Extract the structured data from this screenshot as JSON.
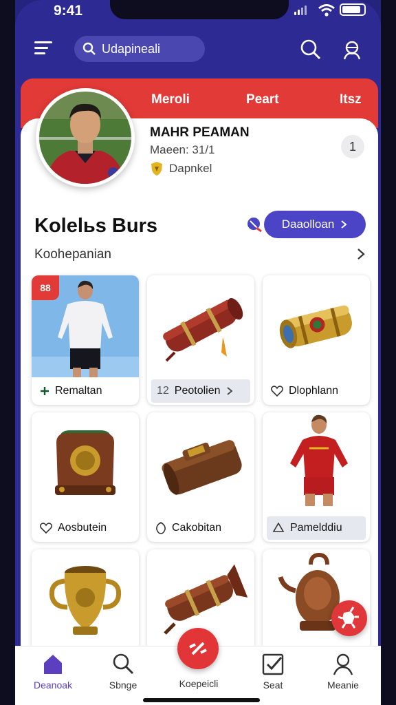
{
  "status": {
    "time": "9:41"
  },
  "search": {
    "text": "Udapineali"
  },
  "tabs": [
    "Meroli",
    "Peart",
    "Itsz"
  ],
  "profile": {
    "name": "MAHR PEAMAN",
    "meta": "Maeen: 31/1",
    "badge": "Dapnkel",
    "action": "1"
  },
  "section": {
    "title": "Kolelьs Burs",
    "button": "Daaolloan",
    "subtitle": "Koohepanian"
  },
  "grid": [
    {
      "label": "Remaltan",
      "icon": "plus-icon"
    },
    {
      "label": "Peotolien",
      "prefix": "12",
      "icon": "chevron-right-icon"
    },
    {
      "label": "Dlophlann",
      "icon": "heart-icon"
    },
    {
      "label": "Aosbutein",
      "icon": "heart-icon"
    },
    {
      "label": "Cakobitan",
      "icon": "leaf-icon"
    },
    {
      "label": "Pamelddiu",
      "icon": "recycle-icon"
    }
  ],
  "tile_tag": "88",
  "nav": [
    {
      "label": "Deanoak"
    },
    {
      "label": "Sbnge"
    },
    {
      "label": "Koepeicli"
    },
    {
      "label": "Seat"
    },
    {
      "label": "Meanie"
    }
  ],
  "colors": {
    "brand": "#2d2b93",
    "accent": "#e23a37",
    "button": "#4b44c6",
    "nav_active": "#5b3fbf"
  }
}
